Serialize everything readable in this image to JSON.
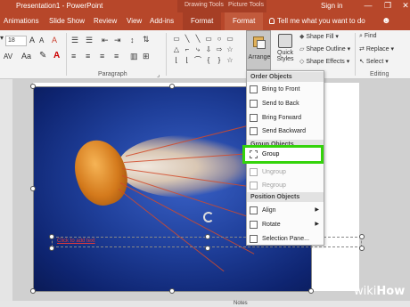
{
  "window": {
    "title": "Presentation1 - PowerPoint",
    "contextual_tools": [
      "Drawing Tools",
      "Picture Tools"
    ],
    "sign_in": "Sign in",
    "controls": [
      "—",
      "❐",
      "✕"
    ]
  },
  "tabs": [
    {
      "label": "Animations"
    },
    {
      "label": "Slide Show"
    },
    {
      "label": "Review"
    },
    {
      "label": "View"
    },
    {
      "label": "Add-ins"
    },
    {
      "label": "Format"
    },
    {
      "label": "Format"
    }
  ],
  "tell_me": "Tell me what you want to do",
  "ribbon": {
    "font_size": "18",
    "groups": [
      "Paragraph",
      "Editing"
    ],
    "arrange_label": "Arrange",
    "quick_styles_label": "Quick Styles",
    "shape_fill": "Shape Fill",
    "shape_outline": "Shape Outline",
    "shape_effects": "Shape Effects",
    "find": "Find",
    "replace": "Replace",
    "select": "Select"
  },
  "slide": {
    "textbox_placeholder": "Click to add text"
  },
  "statusbar": {
    "notes": "Notes"
  },
  "arrange_menu": {
    "order_header": "Order Objects",
    "bring_to_front": "Bring to Front",
    "send_to_back": "Send to Back",
    "bring_forward": "Bring Forward",
    "send_backward": "Send Backward",
    "group_header": "Group Objects",
    "group": "Group",
    "ungroup": "Ungroup",
    "regroup": "Regroup",
    "position_header": "Position Objects",
    "align": "Align",
    "rotate": "Rotate",
    "selection_pane": "Selection Pane..."
  },
  "watermark": {
    "wiki": "wiki",
    "how": "How"
  },
  "colors": {
    "accent": "#b7472a",
    "highlight": "#34d30b"
  }
}
